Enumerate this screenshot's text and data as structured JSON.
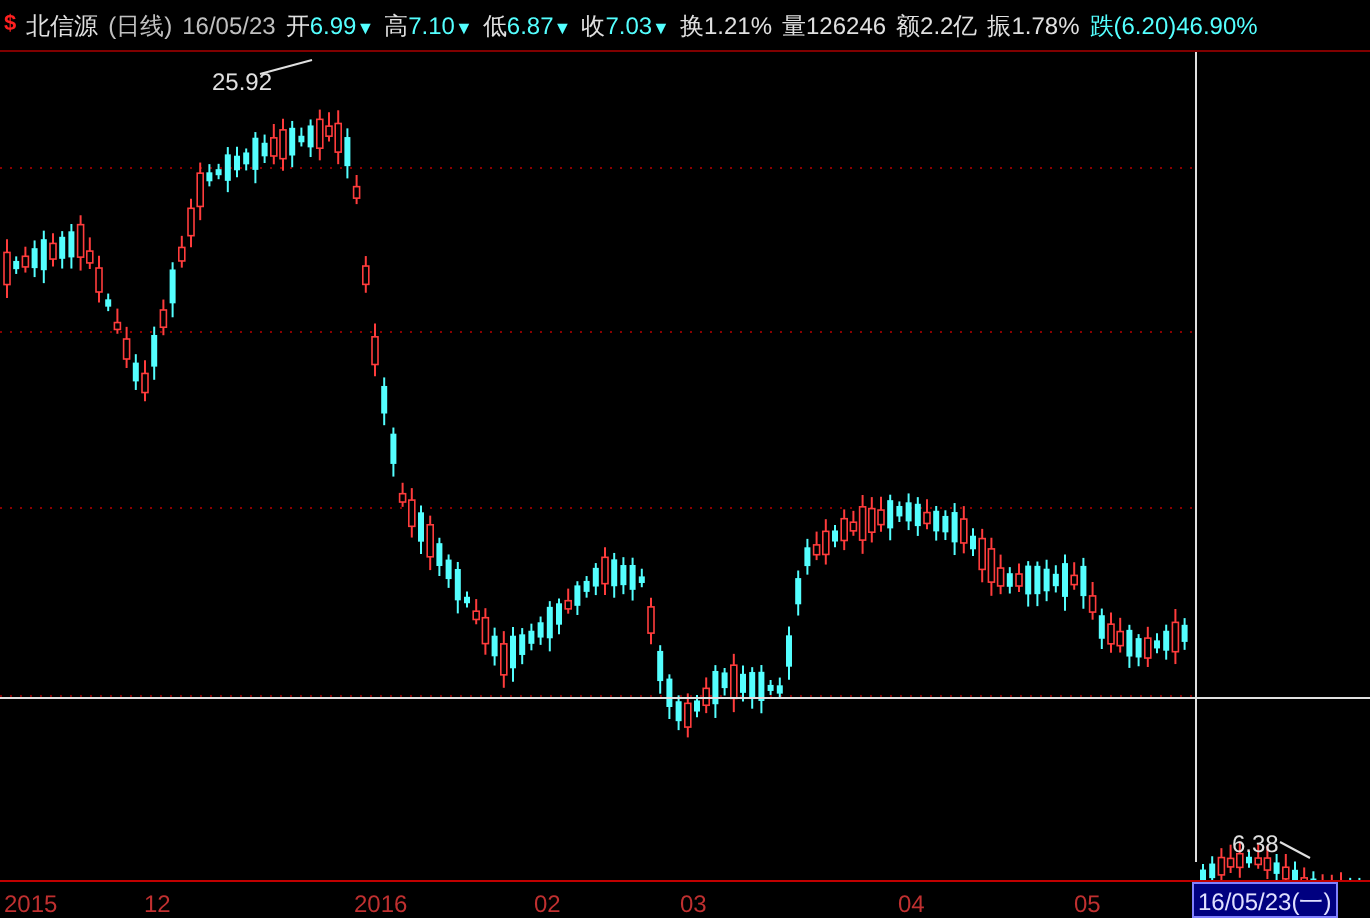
{
  "header": {
    "marker": "$",
    "name": "北信源",
    "period": "(日线)",
    "date": "16/05/23",
    "quotes": [
      {
        "kind": "price",
        "label": "开",
        "value": "6.99",
        "arrow": "▼",
        "color": "#54ffff"
      },
      {
        "kind": "price",
        "label": "高",
        "value": "7.10",
        "arrow": "▼",
        "color": "#54ffff"
      },
      {
        "kind": "price",
        "label": "低",
        "value": "6.87",
        "arrow": "▼",
        "color": "#54ffff"
      },
      {
        "kind": "price",
        "label": "收",
        "value": "7.03",
        "arrow": "▼",
        "color": "#54ffff"
      },
      {
        "kind": "price",
        "label": "换",
        "value": "1.21%",
        "color": "#e0e0e0"
      },
      {
        "kind": "price",
        "label": "量",
        "value": "126246",
        "color": "#e0e0e0"
      },
      {
        "kind": "price",
        "label": "额",
        "value": "2.2亿",
        "color": "#e0e0e0"
      },
      {
        "kind": "price",
        "label": "振",
        "value": "1.78%",
        "color": "#e0e0e0"
      },
      {
        "kind": "change",
        "label": "跌",
        "value": "(6.20)46.90%",
        "color": "#54ffff"
      }
    ]
  },
  "chart": {
    "high_label": "25.92",
    "low_label": "6.38"
  },
  "x_axis": {
    "labels": [
      "2015",
      "12",
      "2016",
      "02",
      "03",
      "04",
      "05"
    ],
    "cursor_date": "16/05/23(一)"
  }
}
